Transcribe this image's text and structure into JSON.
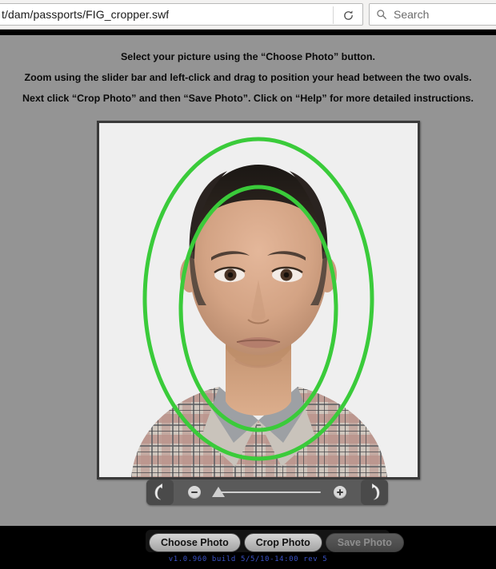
{
  "browser": {
    "url": "t/dam/passports/FIG_cropper.swf",
    "reload_icon": "reload-icon",
    "search_icon": "search-icon",
    "search_placeholder": "Search"
  },
  "app": {
    "instructions": {
      "line1": "Select your picture using the “Choose Photo” button.",
      "line2": "Zoom using the slider bar and left-click and drag to position your head between the two ovals.",
      "line3": "Next click “Crop Photo” and then “Save Photo”.  Click on “Help” for more detailed instructions."
    },
    "photo": {
      "alt": "Passport photo preview of a man facing camera in plaid shirt",
      "guide_color": "#3ACB3A",
      "background_color": "#efefef"
    },
    "toolbar": {
      "rotate_left_icon": "rotate-counterclockwise-icon",
      "rotate_right_icon": "rotate-clockwise-icon",
      "zoom_out_icon": "zoom-out-icon",
      "zoom_in_icon": "zoom-in-icon",
      "slider_value": 4
    },
    "buttons": {
      "choose": "Choose Photo",
      "crop": "Crop Photo",
      "save": "Save Photo",
      "save_enabled": false
    },
    "version": "v1.0.960 build 5/5/10-14:00 rev 5"
  }
}
